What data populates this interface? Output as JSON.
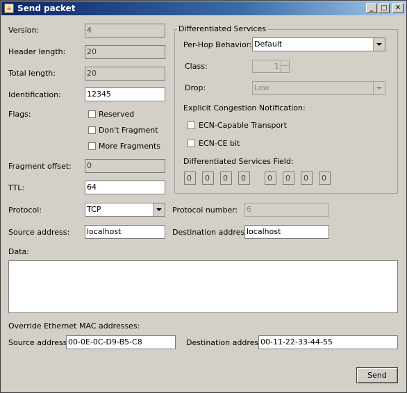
{
  "window": {
    "title": "Send packet",
    "min_label": "_",
    "max_label": "□",
    "close_label": "✕"
  },
  "labels": {
    "version": "Version:",
    "header_length": "Header length:",
    "total_length": "Total length:",
    "identification": "Identification:",
    "flags": "Flags:",
    "fragment_offset": "Fragment offset:",
    "ttl": "TTL:",
    "protocol": "Protocol:",
    "protocol_number": "Protocol number:",
    "source_address": "Source address:",
    "destination_address": "Destination address:",
    "data": "Data:",
    "override_mac": "Override Ethernet MAC addresses:",
    "mac_source_address": "Source address:",
    "mac_destination_address": "Destination address:"
  },
  "values": {
    "version": "4",
    "header_length": "20",
    "total_length": "20",
    "identification": "12345",
    "fragment_offset": "0",
    "ttl": "64",
    "protocol": "TCP",
    "protocol_number": "6",
    "source_address": "localhost",
    "destination_address": "localhost",
    "data": "",
    "mac_source": "00-0E-0C-D9-B5-C8",
    "mac_destination": "00-11-22-33-44-55"
  },
  "flags": {
    "reserved": {
      "label": "Reserved",
      "checked": false
    },
    "dont_fragment": {
      "label": "Don't Fragment",
      "checked": false
    },
    "more_fragments": {
      "label": "More Fragments",
      "checked": false
    }
  },
  "diffserv": {
    "title": "Differentiated Services",
    "phb_label": "Per-Hop Behavior:",
    "phb_value": "Default",
    "class_label": "Class:",
    "class_value": "1",
    "drop_label": "Drop:",
    "drop_value": "Low",
    "ecn_label": "Explicit Congestion Notification:",
    "ecn_capable": {
      "label": "ECN-Capable Transport",
      "checked": false
    },
    "ecn_ce": {
      "label": "ECN-CE bit",
      "checked": false
    },
    "field_label": "Differentiated Services Field:",
    "bits": [
      "0",
      "0",
      "0",
      "0",
      "0",
      "0",
      "0",
      "0"
    ]
  },
  "send_label": "Send",
  "icons": {
    "title_icon": "java-app-icon"
  }
}
